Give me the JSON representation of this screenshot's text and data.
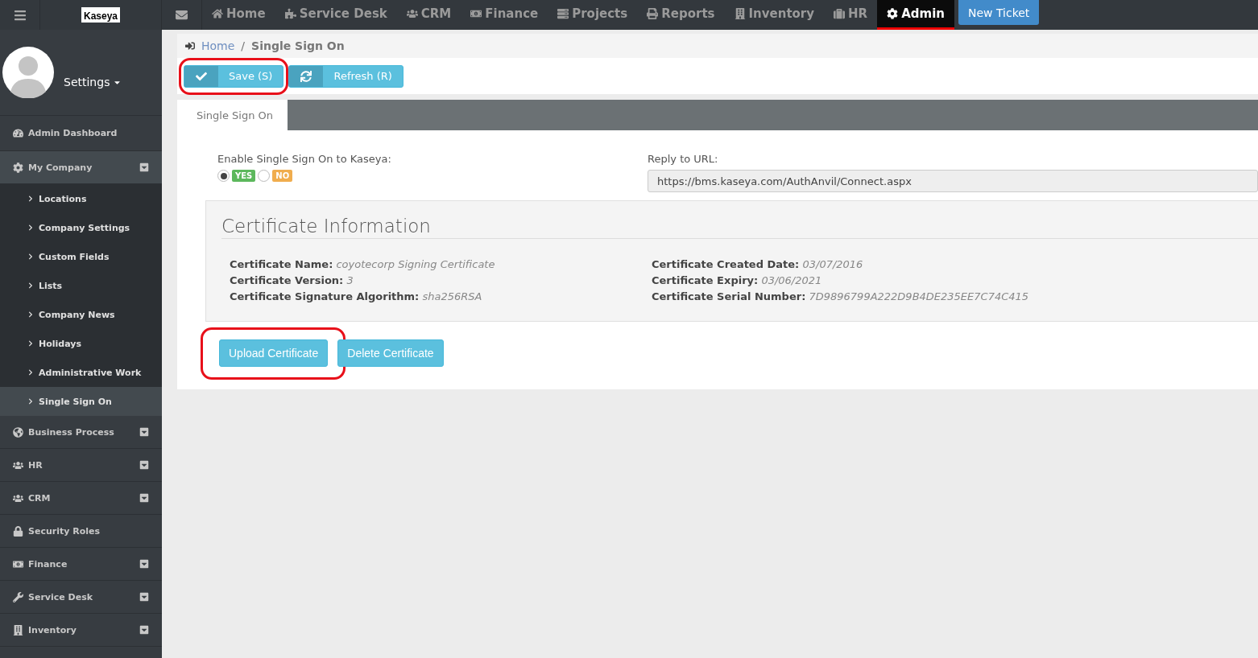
{
  "logo": "Kaseya",
  "nav": [
    {
      "label": "Home",
      "selected": false
    },
    {
      "label": "Service Desk",
      "selected": false
    },
    {
      "label": "CRM",
      "selected": false
    },
    {
      "label": "Finance",
      "selected": false
    },
    {
      "label": "Projects",
      "selected": false
    },
    {
      "label": "Reports",
      "selected": false
    },
    {
      "label": "Inventory",
      "selected": false
    },
    {
      "label": "HR",
      "selected": false
    },
    {
      "label": "Admin",
      "selected": true
    }
  ],
  "new_ticket": "New Ticket",
  "user": {
    "menu": "Settings"
  },
  "sidebar": [
    {
      "label": "Admin Dashboard",
      "expandable": false,
      "selected": false
    },
    {
      "label": "My Company",
      "expandable": true,
      "selected": true,
      "children": [
        {
          "label": "Locations",
          "selected": false
        },
        {
          "label": "Company Settings",
          "selected": false
        },
        {
          "label": "Custom Fields",
          "selected": false
        },
        {
          "label": "Lists",
          "selected": false
        },
        {
          "label": "Company News",
          "selected": false
        },
        {
          "label": "Holidays",
          "selected": false
        },
        {
          "label": "Administrative Work",
          "selected": false
        },
        {
          "label": "Single Sign On",
          "selected": true
        }
      ]
    },
    {
      "label": "Business Process",
      "expandable": true,
      "selected": false
    },
    {
      "label": "HR",
      "expandable": true,
      "selected": false
    },
    {
      "label": "CRM",
      "expandable": true,
      "selected": false
    },
    {
      "label": "Security Roles",
      "expandable": false,
      "selected": false
    },
    {
      "label": "Finance",
      "expandable": true,
      "selected": false
    },
    {
      "label": "Service Desk",
      "expandable": true,
      "selected": false
    },
    {
      "label": "Inventory",
      "expandable": true,
      "selected": false
    }
  ],
  "breadcrumb": [
    {
      "label": "Home",
      "link": true
    },
    {
      "label": "Single Sign On",
      "link": false
    }
  ],
  "breadcrumb_separator": "/",
  "toolbar": [
    {
      "label": "Save (S)",
      "highlighted": true
    },
    {
      "label": "Refresh (R)",
      "highlighted": false
    }
  ],
  "tabs": [
    {
      "label": "Single Sign On",
      "selected": true
    }
  ],
  "sso": {
    "label": "Enable Single Sign On to Kaseya:",
    "options": [
      {
        "label": "YES",
        "selected": true,
        "color": "#5cb85c"
      },
      {
        "label": "NO",
        "selected": false,
        "color": "#f0ad4e"
      }
    ]
  },
  "reply_url": {
    "label": "Reply to URL:",
    "value": "https://bms.kaseya.com/AuthAnvil/Connect.aspx"
  },
  "certificate": {
    "title": "Certificate Information",
    "left": [
      {
        "label": "Certificate Name:",
        "value": "coyotecorp Signing Certificate"
      },
      {
        "label": "Certificate Version:",
        "value": "3"
      },
      {
        "label": "Certificate Signature Algorithm:",
        "value": "sha256RSA"
      }
    ],
    "right": [
      {
        "label": "Certificate Created Date:",
        "value": "03/07/2016"
      },
      {
        "label": "Certificate Expiry:",
        "value": "03/06/2021"
      },
      {
        "label": "Certificate Serial Number:",
        "value": "7D9896799A222D9B4DE235EE7C74C415"
      }
    ]
  },
  "actions": [
    {
      "label": "Upload Certificate",
      "highlighted": true
    },
    {
      "label": "Delete Certificate",
      "highlighted": false
    }
  ]
}
